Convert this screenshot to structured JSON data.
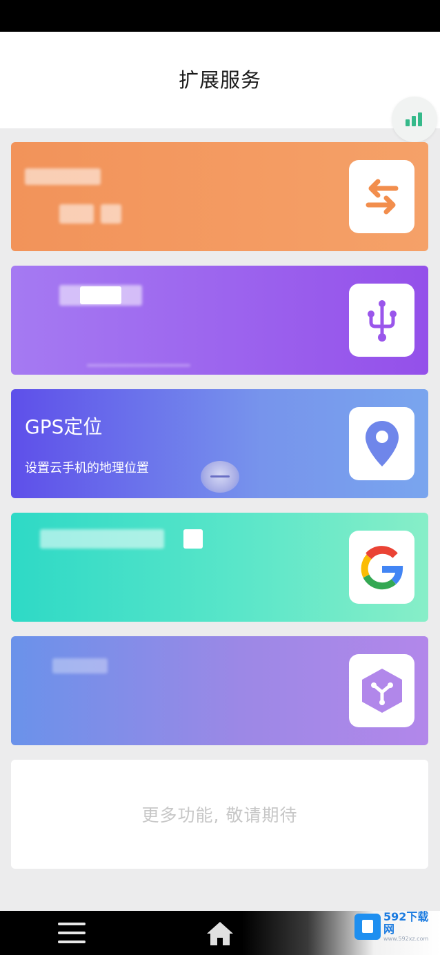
{
  "header": {
    "title": "扩展服务"
  },
  "cards": [
    {
      "title": "",
      "subtitle": "",
      "icon": "swap-arrows-icon"
    },
    {
      "title": "",
      "subtitle": "",
      "icon": "usb-icon"
    },
    {
      "title": "GPS定位",
      "subtitle": "设置云手机的地理位置",
      "icon": "location-pin-icon"
    },
    {
      "title": "",
      "subtitle": "",
      "icon": "google-icon"
    },
    {
      "title": "",
      "subtitle": "",
      "icon": "cube-icon"
    }
  ],
  "more": {
    "label": "更多功能, 敬请期待"
  },
  "nav": {
    "menu_icon": "menu-icon",
    "home_icon": "home-icon"
  },
  "watermark": {
    "main": "592下载网",
    "url": "www.592xz.com"
  },
  "colors": {
    "card_orange": "#f2935a",
    "card_purple": "#9450ea",
    "card_indigo": "#5e4fea",
    "card_teal": "#2ed9c6",
    "card_lavender": "#9c88e6",
    "signal_green": "#35b98a"
  }
}
